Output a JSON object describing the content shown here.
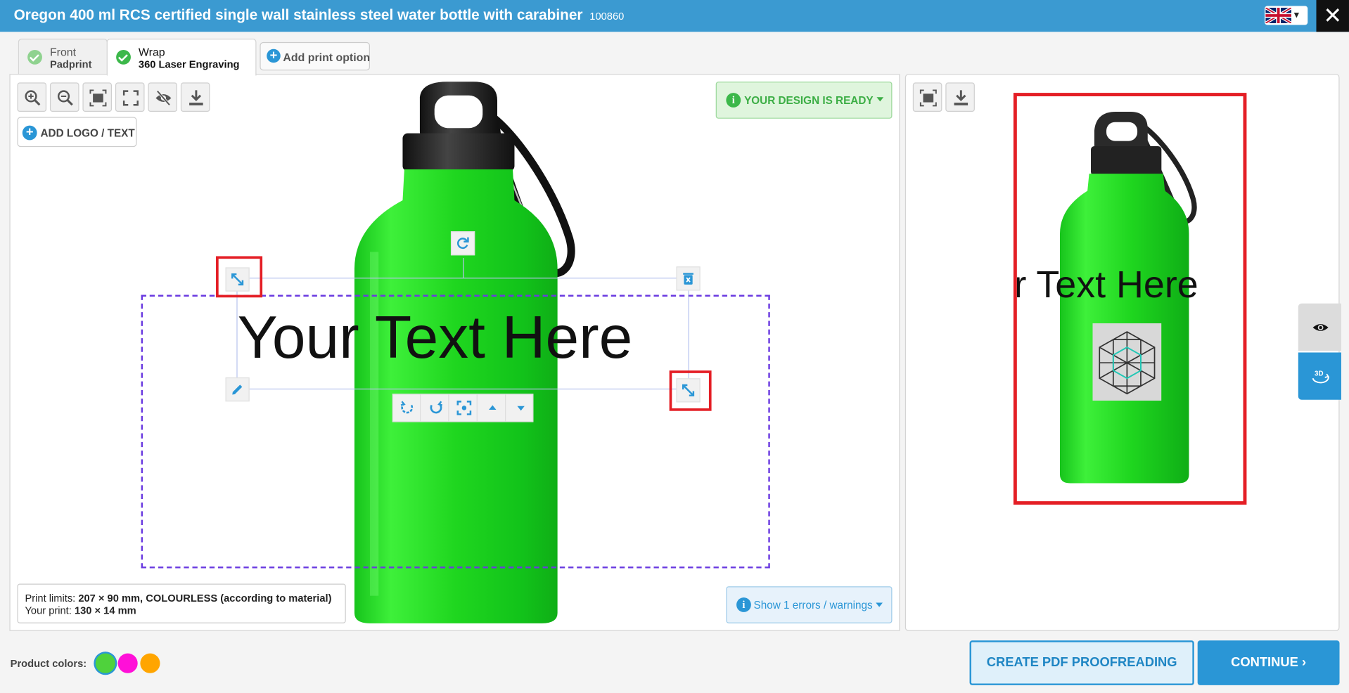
{
  "header": {
    "title": "Oregon 400 ml RCS certified single wall stainless steel water bottle with carabiner",
    "product_code": "100860",
    "language_flag": "uk-flag-icon"
  },
  "tabs": [
    {
      "label_top": "Front",
      "label_bottom": "Padprint",
      "completed": true,
      "active": false
    },
    {
      "label_top": "Wrap",
      "label_bottom": "360 Laser Engraving",
      "completed": true,
      "active": true
    }
  ],
  "add_print_option": "Add print option",
  "toolbar": {
    "icons": [
      "zoom-in-icon",
      "zoom-out-icon",
      "fit-screen-icon",
      "fullscreen-icon",
      "hide-icon",
      "download-icon"
    ],
    "add_logo_label": "ADD LOGO / TEXT"
  },
  "status": {
    "ready_label": "YOUR DESIGN IS READY",
    "errors_label": "Show 1 errors / warnings"
  },
  "design": {
    "text": "Your Text Here"
  },
  "print_info": {
    "limits_prefix": "Print limits:",
    "limits_value": "207 × 90 mm, COLOURLESS (according to material)",
    "your_print_prefix": "Your print:",
    "your_print_value": "130 × 14 mm"
  },
  "preview": {
    "text": "Your Text Here"
  },
  "product_colors": {
    "label": "Product colors:",
    "colors": [
      "#4fd23c",
      "#ff10d8",
      "#ffa500"
    ],
    "selected": 0
  },
  "actions": {
    "pdf_label": "CREATE PDF PROOFREADING",
    "continue_label": "CONTINUE"
  },
  "theme": {
    "accent": "#2a96d6",
    "header": "#3b9ad1",
    "bottle_green": "#26e02e",
    "highlight": "#e41e25"
  }
}
